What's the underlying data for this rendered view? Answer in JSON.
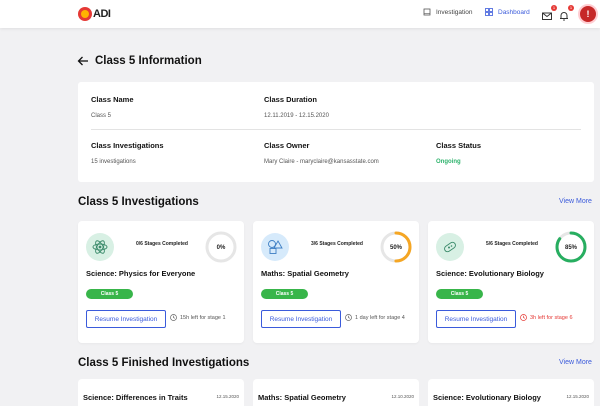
{
  "app": {
    "logo_text": "ADI"
  },
  "nav": {
    "investigation_label": "Investigation",
    "dashboard_label": "Dashboard",
    "mail_badge": "1",
    "bell_badge": "1",
    "avatar_initial": "!"
  },
  "page": {
    "title": "Class 5 Information"
  },
  "info": {
    "class_name_label": "Class Name",
    "class_name_value": "Class 5",
    "duration_label": "Class Duration",
    "duration_value": "12.11.2019 - 12.15.2020",
    "investigations_label": "Class Investigations",
    "investigations_value": "15 investigations",
    "owner_label": "Class Owner",
    "owner_value": "Mary Claire - maryclaire@kansasstate.com",
    "status_label": "Class Status",
    "status_value": "Ongoing",
    "status_color": "#2fb36d"
  },
  "investigations_section": {
    "title": "Class 5 Investigations",
    "view_more": "View More"
  },
  "investigations": [
    {
      "icon": "atom-icon",
      "icon_bg": "#d8f0e4",
      "stages": "0/6 Stages Completed",
      "percent": "0%",
      "progress": 0,
      "ring_color": "#9aa0a6",
      "title": "Science: Physics for Everyone",
      "class_pill": "Class 5",
      "resume": "Resume Investigation",
      "time_left": "15h left for stage 1",
      "urgent": false
    },
    {
      "icon": "shapes-icon",
      "icon_bg": "#d6eafb",
      "stages": "3/6 Stages Completed",
      "percent": "50%",
      "progress": 0.5,
      "ring_color": "#f5a623",
      "title": "Maths: Spatial Geometry",
      "class_pill": "Class 5",
      "resume": "Resume Investigation",
      "time_left": "1 day left for stage 4",
      "urgent": false
    },
    {
      "icon": "microbe-icon",
      "icon_bg": "#d8f0e4",
      "stages": "5/6 Stages Completed",
      "percent": "85%",
      "progress": 0.85,
      "ring_color": "#27ae60",
      "title": "Science: Evolutionary Biology",
      "class_pill": "Class 5",
      "resume": "Resume Investigation",
      "time_left": "3h left for stage 6",
      "urgent": true
    }
  ],
  "finished_section": {
    "title": "Class 5 Finished Investigations",
    "view_more": "View More"
  },
  "finished": [
    {
      "title": "Science: Differences in Traits",
      "date": "12.15.2020"
    },
    {
      "title": "Maths: Spatial Geometry",
      "date": "12.10.2020"
    },
    {
      "title": "Science: Evolutionary Biology",
      "date": "12.15.2020"
    }
  ]
}
